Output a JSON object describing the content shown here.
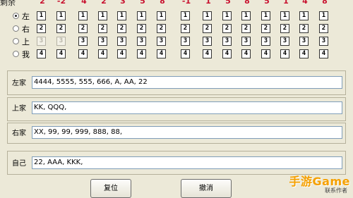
{
  "top_strip": {
    "label": "剩余",
    "counts": [
      "2",
      "-2",
      "4",
      "2",
      "3",
      "5",
      "8",
      "-1",
      "1",
      "5",
      "8",
      "5",
      "1",
      "4",
      "8"
    ]
  },
  "players": [
    {
      "label": "左",
      "selected": true,
      "cells": [
        "1",
        "1",
        "1",
        "1",
        "1",
        "1",
        "1",
        "1",
        "1",
        "1",
        "1",
        "1",
        "1",
        "1",
        "1"
      ]
    },
    {
      "label": "右",
      "selected": false,
      "cells": [
        "2",
        "2",
        "2",
        "2",
        "2",
        "2",
        "2",
        "2",
        "2",
        "2",
        "2",
        "2",
        "2",
        "2",
        "2"
      ]
    },
    {
      "label": "上",
      "selected": false,
      "cells": [
        "3",
        "3",
        "3",
        "3",
        "3",
        "3",
        "3",
        "3",
        "3",
        "3",
        "3",
        "3",
        "3",
        "3",
        "3"
      ]
    },
    {
      "label": "我",
      "selected": false,
      "cells": [
        "4",
        "4",
        "4",
        "4",
        "4",
        "4",
        "4",
        "4",
        "4",
        "4",
        "4",
        "4",
        "4",
        "4",
        "4"
      ]
    }
  ],
  "hands": [
    {
      "label": "左家",
      "value": "4444, 5555, 555, 666, A, AA, 22"
    },
    {
      "label": "上家",
      "value": "KK, QQQ,"
    },
    {
      "label": "右家",
      "value": "XX, 99, 99, 999, 888, 88,"
    },
    {
      "label": "自己",
      "value": "22, AAA, KKK,"
    }
  ],
  "buttons": {
    "reset": "复位",
    "undo": "撤消"
  },
  "watermark": {
    "main": "手游Game",
    "sub": "联系作者"
  }
}
